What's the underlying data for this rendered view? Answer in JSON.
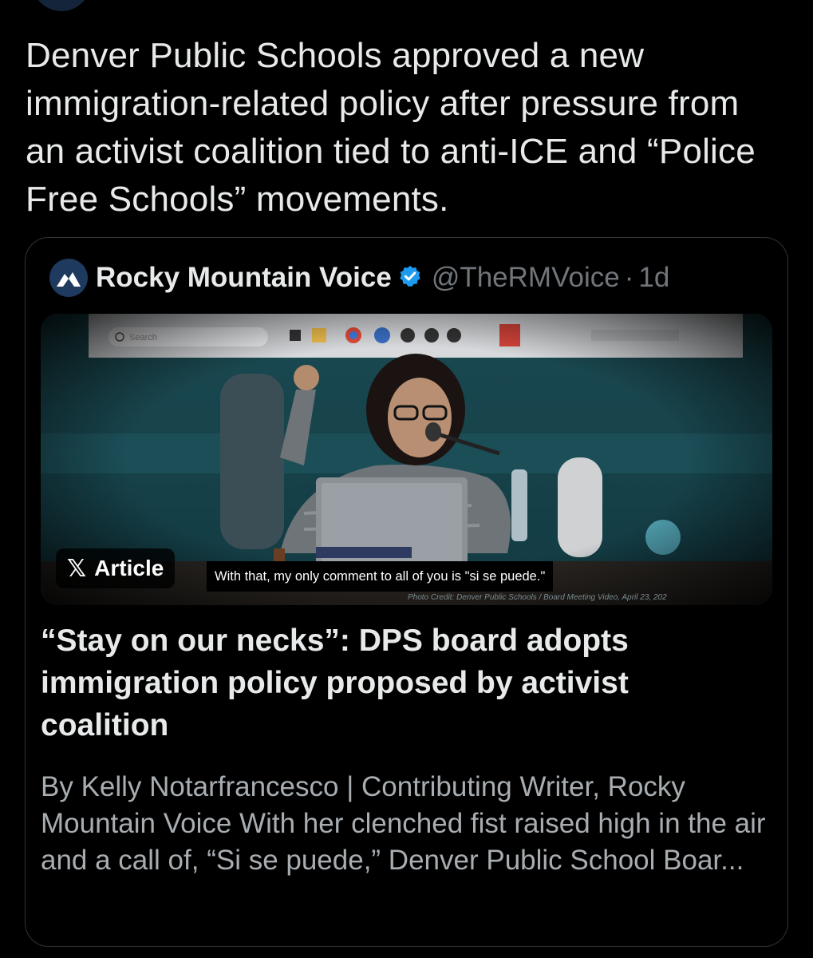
{
  "tweet": {
    "text": "Denver Public Schools approved a new immigration-related policy after pressure from an activist coalition tied to anti-ICE and “Police Free Schools” movements."
  },
  "quote": {
    "author_name": "Rocky Mountain Voice",
    "handle": "@TheRMVoice",
    "separator": "·",
    "time_ago": "1d",
    "verified": true,
    "article_badge_logo": "𝕏",
    "article_badge_label": "Article",
    "media": {
      "caption": "With that, my only comment to all of you is \"si se puede.\"",
      "taskbar_search": "Search",
      "photo_credit": "Photo Credit: Denver Public Schools / Board Meeting Video, April 23, 202"
    },
    "article_title": "“Stay on our necks”: DPS board adopts immigration policy proposed by activist coalition",
    "article_description": "By Kelly Notarfrancesco | Contributing Writer, Rocky Mountain Voice With her clenched fist raised high in the air and a call of, “Si se puede,” Denver Public School Boar..."
  },
  "colors": {
    "background": "#000000",
    "text_primary": "#e7e9ea",
    "text_secondary": "#71767b",
    "border": "#2f3336",
    "verified_blue": "#1d9bf0"
  },
  "icons": [
    "mountain-logo-icon",
    "verified-badge-icon",
    "x-logo-icon"
  ]
}
